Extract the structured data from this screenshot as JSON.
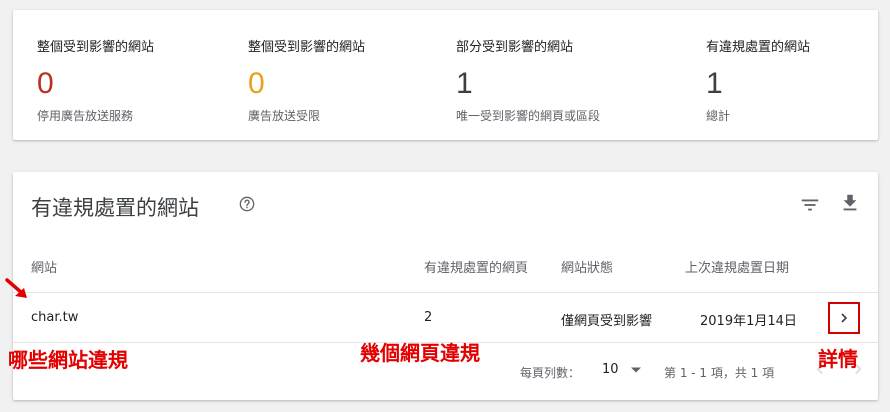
{
  "summary": [
    {
      "title": "整個受到影響的網站",
      "count": "0",
      "sub": "停用廣告放送服務",
      "color": "#b93221"
    },
    {
      "title": "整個受到影響的網站",
      "count": "0",
      "sub": "廣告放送受限",
      "color": "#e8a21a"
    },
    {
      "title": "部分受到影響的網站",
      "count": "1",
      "sub": "唯一受到影響的網頁或區段",
      "color": "#3c4043"
    },
    {
      "title": "有違規處置的網站",
      "count": "1",
      "sub": "總計",
      "color": "#3c4043"
    }
  ],
  "table": {
    "title": "有違規處置的網站",
    "columns": [
      "網站",
      "有違規處置的網頁",
      "網站狀態",
      "上次違規處置日期"
    ],
    "rows": [
      {
        "site": "char.tw",
        "pages": "2",
        "status": "僅網頁受到影響",
        "date": "2019年1月14日"
      }
    ],
    "pagination": {
      "rows_per_page_label": "每頁列數：",
      "rows_per_page": "10",
      "range": "第 1 - 1 項，共 1 項"
    }
  },
  "annotations": {
    "site": "哪些網站違規",
    "pages": "幾個網頁違規",
    "details": "詳情"
  },
  "icons": [
    "help-icon",
    "filter-icon",
    "download-icon",
    "chevron-right-icon",
    "chevron-left-icon",
    "dropdown-arrow-icon",
    "red-arrow-icon"
  ],
  "colors": {
    "annotation": "#e30000",
    "link_gray": "#5f6368"
  }
}
